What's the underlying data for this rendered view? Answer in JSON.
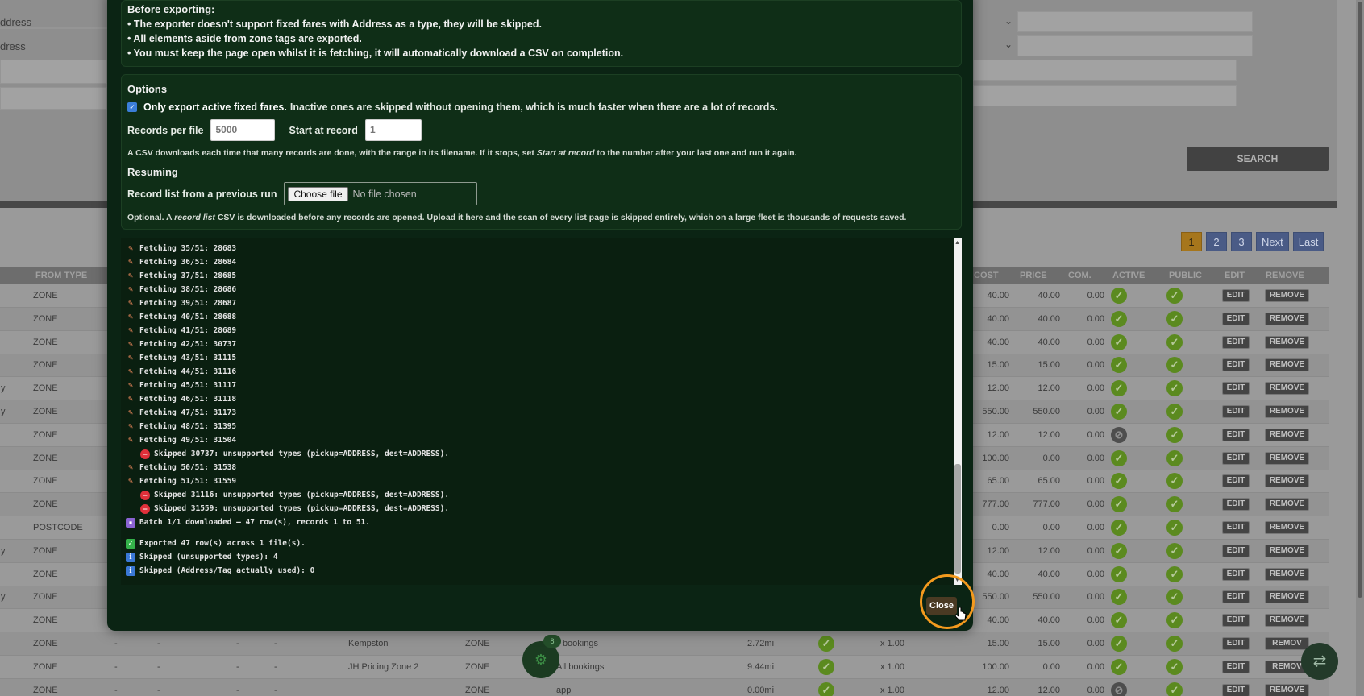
{
  "background": {
    "address_labels": [
      "ddress",
      "dress"
    ],
    "search_label": "SEARCH",
    "pager": [
      "1",
      "2",
      "3",
      "Next",
      "Last"
    ],
    "columns_left": [
      "FROM TYPE"
    ],
    "columns_right": [
      "COST",
      "PRICE",
      "COM.",
      "ACTIVE",
      "PUBLIC",
      "EDIT",
      "REMOVE"
    ],
    "edit_label": "EDIT",
    "remove_label": "REMOVE",
    "remove_truncated": "REMOV",
    "rows": [
      {
        "pre": "",
        "type": "ZONE",
        "cost": "40.00",
        "price": "40.00",
        "com": "0.00",
        "active": true
      },
      {
        "pre": "",
        "type": "ZONE",
        "cost": "40.00",
        "price": "40.00",
        "com": "0.00",
        "active": true
      },
      {
        "pre": "",
        "type": "ZONE",
        "cost": "40.00",
        "price": "40.00",
        "com": "0.00",
        "active": true
      },
      {
        "pre": "",
        "type": "ZONE",
        "cost": "15.00",
        "price": "15.00",
        "com": "0.00",
        "active": true
      },
      {
        "pre": "y",
        "type": "ZONE",
        "cost": "12.00",
        "price": "12.00",
        "com": "0.00",
        "active": true
      },
      {
        "pre": "y",
        "type": "ZONE",
        "cost": "550.00",
        "price": "550.00",
        "com": "0.00",
        "active": true
      },
      {
        "pre": "",
        "type": "ZONE",
        "cost": "12.00",
        "price": "12.00",
        "com": "0.00",
        "active": false
      },
      {
        "pre": "",
        "type": "ZONE",
        "cost": "100.00",
        "price": "0.00",
        "com": "0.00",
        "active": true
      },
      {
        "pre": "",
        "type": "ZONE",
        "cost": "65.00",
        "price": "65.00",
        "com": "0.00",
        "active": true
      },
      {
        "pre": "",
        "type": "ZONE",
        "cost": "777.00",
        "price": "777.00",
        "com": "0.00",
        "active": true
      },
      {
        "pre": "",
        "type": "POSTCODE",
        "cost": "0.00",
        "price": "0.00",
        "com": "0.00",
        "active": true
      },
      {
        "pre": "y",
        "type": "ZONE",
        "cost": "12.00",
        "price": "12.00",
        "com": "0.00",
        "active": true
      },
      {
        "pre": "",
        "type": "ZONE",
        "cost": "40.00",
        "price": "40.00",
        "com": "0.00",
        "active": true
      },
      {
        "pre": "y",
        "type": "ZONE",
        "cost": "550.00",
        "price": "550.00",
        "com": "0.00",
        "active": true
      },
      {
        "pre": "",
        "type": "ZONE",
        "cost": "40.00",
        "price": "40.00",
        "com": "0.00",
        "active": true
      },
      {
        "pre": "",
        "type": "ZONE",
        "cost": "15.00",
        "price": "15.00",
        "com": "0.00",
        "active": true,
        "dash": [
          "-",
          "-",
          "-",
          "-"
        ],
        "to_name": "Kempston",
        "to_type": "ZONE",
        "bookings": "ll bookings",
        "dist": "2.72mi",
        "mult": "x 1.00"
      },
      {
        "pre": "",
        "type": "ZONE",
        "cost": "100.00",
        "price": "0.00",
        "com": "0.00",
        "active": true,
        "dash": [
          "-",
          "-",
          "-",
          "-"
        ],
        "to_name": "JH Pricing Zone 2",
        "to_type": "ZONE",
        "bookings": "All bookings",
        "dist": "9.44mi",
        "mult": "x 1.00"
      },
      {
        "pre": "",
        "type": "ZONE",
        "cost": "12.00",
        "price": "12.00",
        "com": "0.00",
        "active": false,
        "dash": [
          "-",
          "-",
          "-",
          "-"
        ],
        "to_name": "",
        "to_type": "ZONE",
        "bookings": "app",
        "dist": "0.00mi",
        "mult": "x 1.00"
      }
    ],
    "fab_badge": "8"
  },
  "modal": {
    "before_title": "Before exporting:",
    "before_lines": [
      "• The exporter doesn't support fixed fares with Address as a type, they will be skipped.",
      "• All elements aside from zone tags are exported.",
      "• You must keep the page open whilst it is fetching, it will automatically download a CSV on completion."
    ],
    "options_title": "Options",
    "only_active_strong": "Only export active fixed fares.",
    "only_active_rest": "Inactive ones are skipped without opening them, which is much faster when there are a lot of records.",
    "records_per_file_label": "Records per file",
    "records_per_file_value": "5000",
    "start_at_record_label": "Start at record",
    "start_at_record_value": "1",
    "hint_pre": "A CSV downloads each time that many records are done, with the range in its filename. If it stops, set ",
    "hint_em": "Start at record",
    "hint_post": " to the number after your last one and run it again.",
    "resuming_title": "Resuming",
    "record_list_label": "Record list from a previous run",
    "choose_file": "Choose file",
    "no_file": "No file chosen",
    "optional_pre": "Optional. A ",
    "optional_em": "record list",
    "optional_post": " CSV is downloaded before any records are opened. Upload it here and the scan of every list page is skipped entirely, which on a large fleet is thousands of requests saved.",
    "close_label": "Close"
  },
  "log": [
    {
      "icon": "pencil",
      "text": "Fetching 35/51: 28683"
    },
    {
      "icon": "pencil",
      "text": "Fetching 36/51: 28684"
    },
    {
      "icon": "pencil",
      "text": "Fetching 37/51: 28685"
    },
    {
      "icon": "pencil",
      "text": "Fetching 38/51: 28686"
    },
    {
      "icon": "pencil",
      "text": "Fetching 39/51: 28687"
    },
    {
      "icon": "pencil",
      "text": "Fetching 40/51: 28688"
    },
    {
      "icon": "pencil",
      "text": "Fetching 41/51: 28689"
    },
    {
      "icon": "pencil",
      "text": "Fetching 42/51: 30737"
    },
    {
      "icon": "pencil",
      "text": "Fetching 43/51: 31115"
    },
    {
      "icon": "pencil",
      "text": "Fetching 44/51: 31116"
    },
    {
      "icon": "pencil",
      "text": "Fetching 45/51: 31117"
    },
    {
      "icon": "pencil",
      "text": "Fetching 46/51: 31118"
    },
    {
      "icon": "pencil",
      "text": "Fetching 47/51: 31173"
    },
    {
      "icon": "pencil",
      "text": "Fetching 48/51: 31395"
    },
    {
      "icon": "pencil",
      "text": "Fetching 49/51: 31504"
    },
    {
      "icon": "stop",
      "indent": true,
      "text": "Skipped 30737: unsupported types (pickup=ADDRESS, dest=ADDRESS)."
    },
    {
      "icon": "pencil",
      "text": "Fetching 50/51: 31538"
    },
    {
      "icon": "pencil",
      "text": "Fetching 51/51: 31559"
    },
    {
      "icon": "stop",
      "indent": true,
      "text": "Skipped 31116: unsupported types (pickup=ADDRESS, dest=ADDRESS)."
    },
    {
      "icon": "stop",
      "indent": true,
      "text": "Skipped 31559: unsupported types (pickup=ADDRESS, dest=ADDRESS)."
    },
    {
      "icon": "save",
      "text": "Batch 1/1 downloaded – 47 row(s), records 1 to 51."
    },
    {
      "gap": true
    },
    {
      "icon": "ok",
      "text": "Exported 47 row(s) across 1 file(s)."
    },
    {
      "icon": "info",
      "text": "Skipped (unsupported types): 4"
    },
    {
      "icon": "info",
      "text": "Skipped (Address/Tag actually used): 0"
    }
  ],
  "icons": {
    "pencil": "✎",
    "stop": "—",
    "save": "▪",
    "ok": "✓",
    "info": "i",
    "check": "✓",
    "blocked": "⊘",
    "swap": "⇄",
    "chev": "⌄",
    "cursor": "➤",
    "up": "▲",
    "down": "▼"
  }
}
